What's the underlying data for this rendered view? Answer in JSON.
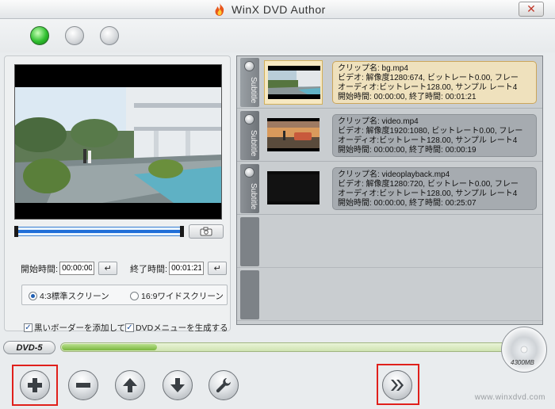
{
  "window": {
    "title": "WinX DVD Author",
    "close_icon": "close-x-icon"
  },
  "status_indicators": [
    "green",
    "gray",
    "gray"
  ],
  "preview": {
    "snapshot_icon": "camera-icon"
  },
  "trim": {
    "start_label": "開始時間:",
    "start_value": "00:00:00",
    "end_label": "終了時間:",
    "end_value": "00:01:21",
    "enter_icon": "↵"
  },
  "aspect": {
    "option_43": "4:3標準スクリーン",
    "option_169": "16:9ワイドスクリーン",
    "selected": "4:3"
  },
  "options": {
    "black_border": "黒いボーダーを添加して",
    "dvd_menu": "DVDメニューを生成する"
  },
  "clips": [
    {
      "subtitle_tab": "Subtitle",
      "name": "クリップ名:  bg.mp4",
      "video": "ビデオ:  解像度1280:674, ビットレート0.00, フレー",
      "audio": "オーディオ:ビットレート128.00, サンプル  レート4",
      "time": "開始時間:    00:00:00, 終了時間:     00:01:21",
      "selected": true
    },
    {
      "subtitle_tab": "Subtitle",
      "name": "クリップ名:  video.mp4",
      "video": "ビデオ:  解像度1920:1080, ビットレート0.00, フレー",
      "audio": "オーディオ:ビットレート128.00, サンプル  レート4",
      "time": "開始時間:    00:00:00, 終了時間:     00:00:19",
      "selected": false
    },
    {
      "subtitle_tab": "Subtitle",
      "name": "クリップ名:  videoplayback.mp4",
      "video": "ビデオ:  解像度1280:720, ビットレート0.00, フレー",
      "audio": "オーディオ:ビットレート128.00, サンプル  レート4",
      "time": "開始時間:    00:00:00, 終了時間:     00:25:07",
      "selected": false
    }
  ],
  "capacity": {
    "disc_type": "DVD-5",
    "disc_label": "4300MB",
    "used_fraction": 0.21
  },
  "toolbar": {
    "add_icon": "plus-icon",
    "remove_icon": "minus-icon",
    "up_icon": "arrow-up-icon",
    "down_icon": "arrow-down-icon",
    "settings_icon": "wrench-icon",
    "next_icon": "double-chevron-right-icon"
  },
  "watermark": "www.winxdvd.com",
  "colors": {
    "highlight": "#e0201b",
    "accent_blue": "#1e6ed8",
    "selected_clip": "#efe1bd"
  }
}
